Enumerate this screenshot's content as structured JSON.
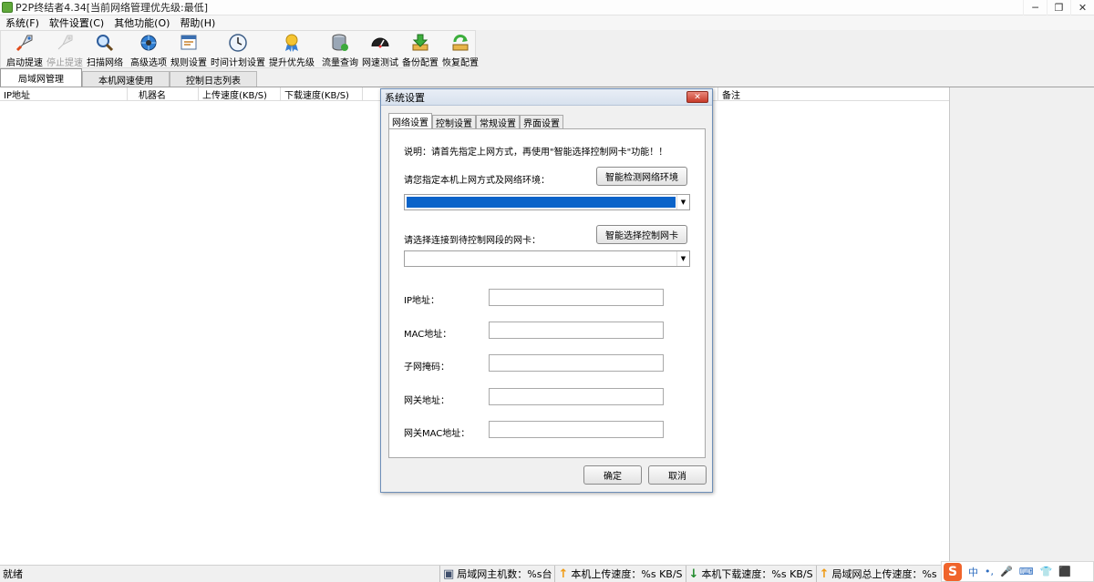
{
  "window": {
    "title": "P2P终结者4.34[当前网络管理优先级:最低]",
    "min": "─",
    "restore": "❐",
    "close": "✕"
  },
  "menu": [
    "系统(F)",
    "软件设置(C)",
    "其他功能(O)",
    "帮助(H)"
  ],
  "toolbar": [
    {
      "label": "启动提速",
      "icon": "rocket-icon",
      "glyph": "🚀"
    },
    {
      "label": "停止提速",
      "icon": "stop-rocket-icon",
      "glyph": "🚀",
      "disabled": true
    },
    {
      "label": "扫描网络",
      "icon": "magnifier-icon",
      "glyph": "🔍"
    },
    {
      "label": "高级选项",
      "icon": "globe-gear-icon",
      "glyph": "🌐"
    },
    {
      "label": "规则设置",
      "icon": "rules-window-icon",
      "glyph": "🗔"
    },
    {
      "label": "时间计划设置",
      "icon": "clock-icon",
      "glyph": "🕓"
    },
    {
      "label": "提升优先级",
      "icon": "medal-icon",
      "glyph": "🏅"
    },
    {
      "label": "流量查询",
      "icon": "database-icon",
      "glyph": "🛢"
    },
    {
      "label": "网速测试",
      "icon": "speedometer-icon",
      "glyph": "⏲"
    },
    {
      "label": "备份配置",
      "icon": "download-icon",
      "glyph": "⬇"
    },
    {
      "label": "恢复配置",
      "icon": "restore-icon",
      "glyph": "♻"
    }
  ],
  "tabs": [
    "局域网管理",
    "本机网速使用",
    "控制日志列表"
  ],
  "grid": {
    "columns": [
      "IP地址",
      "机器名",
      "上传速度(KB/S)",
      "下载速度(KB/S)",
      "备注"
    ]
  },
  "dialog": {
    "title": "系统设置",
    "close": "✕",
    "tabs": [
      "网络设置",
      "控制设置",
      "常规设置",
      "界面设置"
    ],
    "note": "说明：请首先指定上网方式，再使用\"智能选择控制网卡\"功能！！",
    "env_label": "请您指定本机上网方式及网络环境：",
    "detect_button": "智能检测网络环境",
    "nic_label": "请选择连接到待控制网段的网卡：",
    "select_nic_button": "智能选择控制网卡",
    "fields": [
      {
        "label": "IP地址：",
        "value": ""
      },
      {
        "label": "MAC地址：",
        "value": ""
      },
      {
        "label": "子网掩码：",
        "value": ""
      },
      {
        "label": "网关地址：",
        "value": ""
      },
      {
        "label": "网关MAC地址：",
        "value": ""
      }
    ],
    "ok": "确定",
    "cancel": "取消",
    "arrow": "▼"
  },
  "status": {
    "ready": "就绪",
    "hosts": "局域网主机数：%s台",
    "upload": "本机上传速度：%s KB/S",
    "download": "本机下载速度：%s KB/S",
    "lan_upload": "局域网总上传速度：%s KB/S"
  },
  "ime": {
    "logo": "S",
    "items": [
      "中",
      "•,",
      "🎤",
      "⌨",
      "👕",
      "⬛"
    ]
  }
}
